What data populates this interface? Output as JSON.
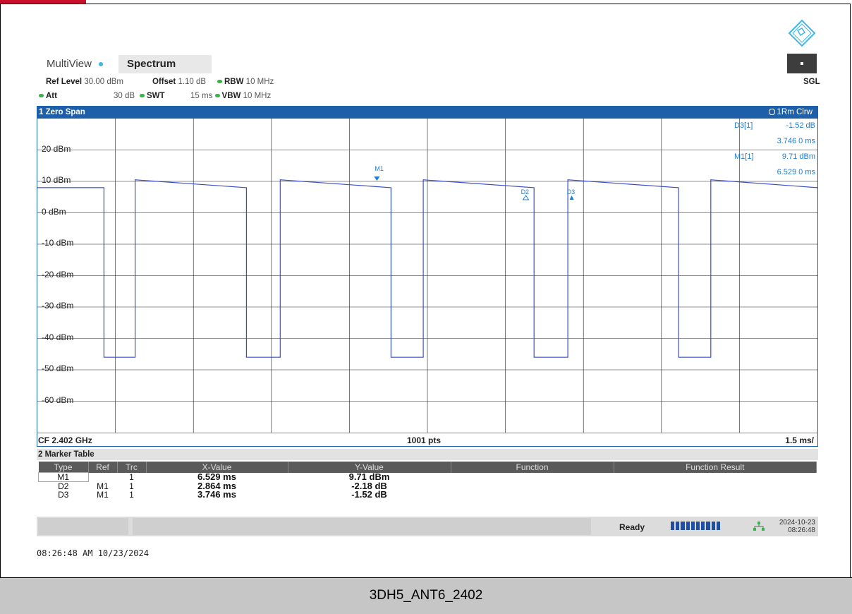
{
  "window": {
    "footer_caption": "3DH5_ANT6_2402",
    "timestamp": "08:26:48 AM  10/23/2024"
  },
  "tabs": [
    {
      "label": "MultiView"
    },
    {
      "label": "Spectrum"
    }
  ],
  "header": {
    "ref_level_label": "Ref Level",
    "ref_level_value": "30.00 dBm",
    "offset_label": "Offset",
    "offset_value": "1.10 dB",
    "rbw_label": "RBW",
    "rbw_value": "10 MHz",
    "att_label": "Att",
    "att_value": "30 dB",
    "swt_label": "SWT",
    "swt_value": "15 ms",
    "vbw_label": "VBW",
    "vbw_value": "10 MHz",
    "sgl": "SGL"
  },
  "diagram": {
    "title": "1 Zero Span",
    "trace_label": "1Rm Clrw",
    "cf": "CF 2.402 GHz",
    "points": "1001 pts",
    "div": "1.5 ms/",
    "marker_info": [
      {
        "label": "D3[1]",
        "value": "-1.52 dB"
      },
      {
        "label": "",
        "value": "3.746 0 ms"
      },
      {
        "label": "M1[1]",
        "value": "9.71 dBm"
      },
      {
        "label": "",
        "value": "6.529 0 ms"
      }
    ],
    "y_tick_labels": [
      "20 dBm",
      "10 dBm",
      "0 dBm",
      "-10 dBm",
      "-20 dBm",
      "-30 dBm",
      "-40 dBm",
      "-50 dBm",
      "-60 dBm"
    ],
    "marker_labels": [
      "M1",
      "D2",
      "D3"
    ]
  },
  "chart_data": {
    "type": "line",
    "title": "1 Zero Span",
    "xlabel": "",
    "ylabel": "",
    "xlim": [
      0,
      15
    ],
    "ylim": [
      -70,
      30
    ],
    "x_unit": "ms",
    "y_unit": "dBm",
    "grid": true,
    "series": [
      {
        "name": "1Rm Clrw",
        "x": [
          0,
          1.28,
          1.28,
          1.88,
          1.88,
          4.02,
          4.02,
          4.67,
          4.67,
          6.8,
          6.8,
          7.42,
          7.42,
          9.55,
          9.55,
          10.2,
          10.2,
          12.33,
          12.33,
          12.95,
          12.95,
          15
        ],
        "y": [
          8,
          8,
          -46,
          -46,
          10.5,
          8,
          -46,
          -46,
          10.5,
          8,
          -46,
          -46,
          10.5,
          8,
          -46,
          -46,
          10.5,
          8,
          -46,
          -46,
          10.5,
          8
        ]
      }
    ],
    "markers": [
      {
        "name": "M1",
        "x_ms": 6.529,
        "y": "9.71 dBm"
      },
      {
        "name": "D2",
        "x_ms": 9.393,
        "y": "-2.18 dB"
      },
      {
        "name": "D3",
        "x_ms": 10.275,
        "y": "-1.52 dB"
      }
    ]
  },
  "marker_table": {
    "title": "2 Marker Table",
    "columns": [
      "Type",
      "Ref",
      "Trc",
      "X-Value",
      "Y-Value",
      "Function",
      "Function Result"
    ],
    "rows": [
      {
        "type": "M1",
        "ref": "",
        "trc": "1",
        "x": "6.529 ms",
        "y": "9.71 dBm",
        "func": "",
        "result": ""
      },
      {
        "type": "D2",
        "ref": "M1",
        "trc": "1",
        "x": "2.864 ms",
        "y": "-2.18 dB",
        "func": "",
        "result": ""
      },
      {
        "type": "D3",
        "ref": "M1",
        "trc": "1",
        "x": "3.746 ms",
        "y": "-1.52 dB",
        "func": "",
        "result": ""
      }
    ]
  },
  "status": {
    "ready": "Ready",
    "date": "2024-10-23",
    "time": "08:26:48"
  },
  "colors": {
    "trace": "#3a4fc8",
    "marker": "#1f7bd0",
    "header_blue": "#1d5fa8",
    "brand_red": "#c8102e"
  },
  "icons": {
    "logo": "rohde-schwarz-diamond-logo",
    "network": "network-icon"
  }
}
